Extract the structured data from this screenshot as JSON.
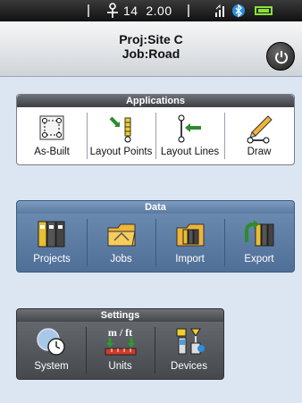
{
  "status": {
    "satellites": "14",
    "precision": "2.00"
  },
  "header": {
    "proj_line": "Proj:Site C",
    "job_line": "Job:Road"
  },
  "applications": {
    "title": "Applications",
    "items": [
      {
        "label": "As-Built",
        "icon": "as-built-icon"
      },
      {
        "label": "Layout Points",
        "icon": "layout-points-icon"
      },
      {
        "label": "Layout Lines",
        "icon": "layout-lines-icon"
      },
      {
        "label": "Draw",
        "icon": "draw-icon"
      }
    ]
  },
  "data_panel": {
    "title": "Data",
    "items": [
      {
        "label": "Projects",
        "icon": "projects-icon"
      },
      {
        "label": "Jobs",
        "icon": "jobs-icon"
      },
      {
        "label": "Import",
        "icon": "import-icon"
      },
      {
        "label": "Export",
        "icon": "export-icon"
      }
    ]
  },
  "settings": {
    "title": "Settings",
    "items": [
      {
        "label": "System",
        "icon": "system-clock-icon"
      },
      {
        "label": "Units",
        "icon": "units-icon",
        "icon_text": "m / ft"
      },
      {
        "label": "Devices",
        "icon": "devices-icon"
      }
    ]
  },
  "colors": {
    "background": "#dbe6f2",
    "data_panel": "#5b7aa2",
    "settings_panel": "#55595e",
    "battery": "#8be13a"
  }
}
